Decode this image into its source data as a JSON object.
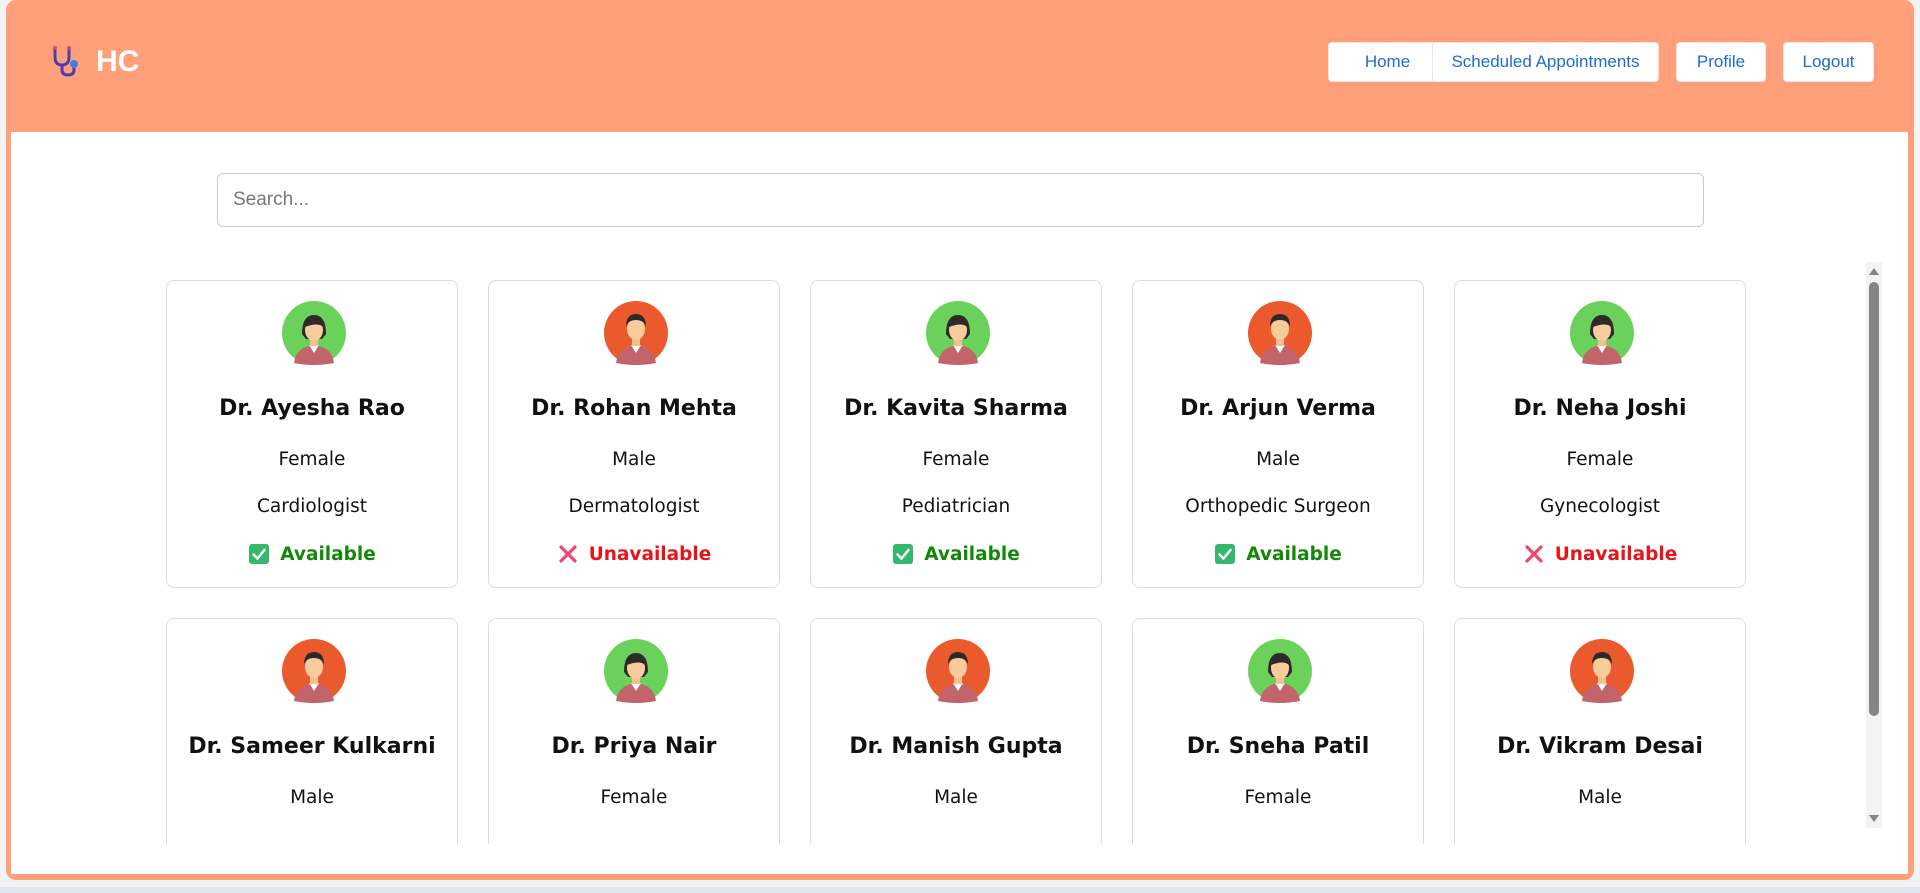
{
  "app": {
    "brand": "HC",
    "brand_icon": "stethoscope-icon"
  },
  "nav": {
    "home": "Home",
    "appointments": "Scheduled Appointments",
    "profile": "Profile",
    "logout": "Logout"
  },
  "search": {
    "placeholder": "Search...",
    "value": ""
  },
  "colors": {
    "header_bg": "#ffa07a",
    "link": "#1a6ecc",
    "available": "#138808",
    "unavailable": "#e8141b",
    "avatar_female_bg": "#6ad25a",
    "avatar_male_bg": "#ea5a2c"
  },
  "doctors": [
    {
      "name": "Dr. Ayesha Rao",
      "gender": "Female",
      "specialty": "Cardiologist",
      "status": "Available"
    },
    {
      "name": "Dr. Rohan Mehta",
      "gender": "Male",
      "specialty": "Dermatologist",
      "status": "Unavailable"
    },
    {
      "name": "Dr. Kavita Sharma",
      "gender": "Female",
      "specialty": "Pediatrician",
      "status": "Available"
    },
    {
      "name": "Dr. Arjun Verma",
      "gender": "Male",
      "specialty": "Orthopedic Surgeon",
      "status": "Available"
    },
    {
      "name": "Dr. Neha Joshi",
      "gender": "Female",
      "specialty": "Gynecologist",
      "status": "Unavailable"
    },
    {
      "name": "Dr. Sameer Kulkarni",
      "gender": "Male"
    },
    {
      "name": "Dr. Priya Nair",
      "gender": "Female"
    },
    {
      "name": "Dr. Manish Gupta",
      "gender": "Male"
    },
    {
      "name": "Dr. Sneha Patil",
      "gender": "Female"
    },
    {
      "name": "Dr. Vikram Desai",
      "gender": "Male"
    }
  ]
}
